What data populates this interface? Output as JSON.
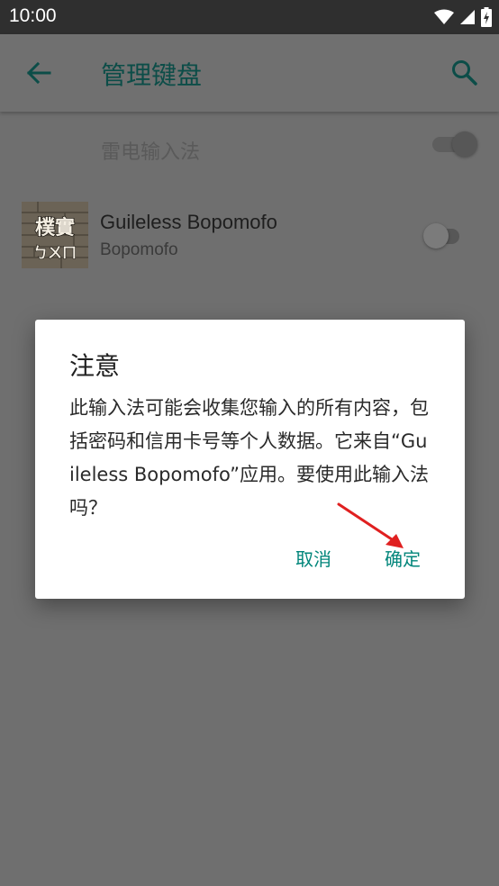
{
  "status_bar": {
    "time": "10:00",
    "icons": [
      "wifi-icon",
      "signal-icon",
      "battery-charging-icon"
    ]
  },
  "app_bar": {
    "title": "管理键盘",
    "back_icon": "arrow-left-icon",
    "search_icon": "search-icon",
    "accent_color": "#0c4d48"
  },
  "keyboards": [
    {
      "title": "雷电输入法",
      "subtitle": "",
      "enabled": true
    },
    {
      "title": "Guileless Bopomofo",
      "subtitle": "Bopomofo",
      "logo_text_top": "樸實",
      "logo_text_bottom": "ㄅㄨㄇ",
      "enabled": false
    }
  ],
  "dialog": {
    "title": "注意",
    "message": "此输入法可能会收集您输入的所有内容，包括密码和信用卡号等个人数据。它来自“Guileless Bopomofo”应用。要使用此输入法吗？",
    "cancel_label": "取消",
    "ok_label": "确定",
    "button_color": "#00857a"
  },
  "annotation": {
    "color": "#e02020",
    "points_to": "ok_button"
  }
}
